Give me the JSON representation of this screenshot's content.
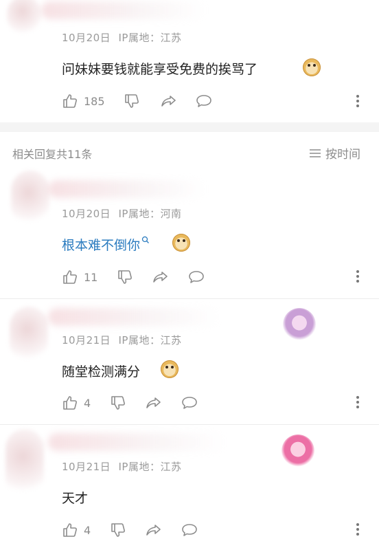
{
  "top_comment": {
    "date": "10月20日",
    "ip": "IP属地：江苏",
    "text": "问妹妹要钱就能享受免费的挨骂了",
    "like_count": "185"
  },
  "replies_header": {
    "title": "相关回复共11条",
    "sort_label": "按时间"
  },
  "replies": [
    {
      "date": "10月20日",
      "ip": "IP属地：河南",
      "text": "根本难不倒你",
      "like_count": "11",
      "text_is_link": true
    },
    {
      "date": "10月21日",
      "ip": "IP属地：江苏",
      "text": "随堂检测满分",
      "like_count": "4"
    },
    {
      "date": "10月21日",
      "ip": "IP属地：江苏",
      "text": "天才",
      "like_count": "4"
    }
  ],
  "colors": {
    "link": "#2a7bbf",
    "meta": "#9a9a9a",
    "icon": "#8c8c8c"
  }
}
